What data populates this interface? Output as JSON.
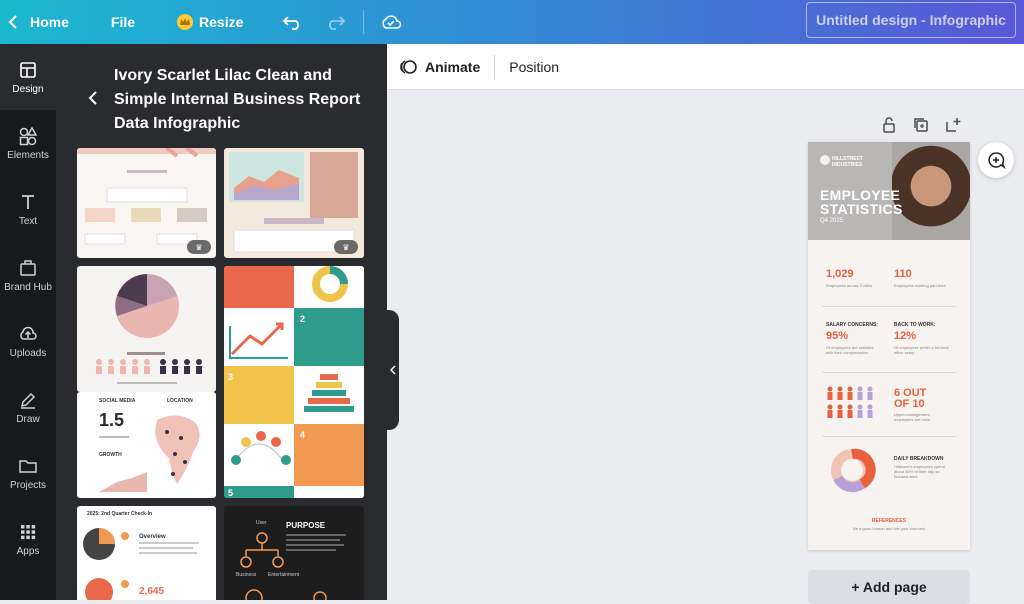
{
  "topbar": {
    "home_label": "Home",
    "file_label": "File",
    "resize_label": "Resize",
    "doc_title": "Untitled design - Infographic"
  },
  "rail": {
    "items": [
      {
        "label": "Design",
        "icon": "layout-icon"
      },
      {
        "label": "Elements",
        "icon": "shapes-icon"
      },
      {
        "label": "Text",
        "icon": "text-icon"
      },
      {
        "label": "Brand Hub",
        "icon": "brand-hub-icon"
      },
      {
        "label": "Uploads",
        "icon": "upload-icon"
      },
      {
        "label": "Draw",
        "icon": "draw-icon"
      },
      {
        "label": "Projects",
        "icon": "folder-icon"
      },
      {
        "label": "Apps",
        "icon": "apps-icon"
      }
    ]
  },
  "panel": {
    "title": "Ivory Scarlet Lilac Clean and Simple Internal Business Report Data Infographic"
  },
  "thumbnails": {
    "t5_stat": "1.5",
    "t5_social": "SOCIAL MEDIA",
    "t5_location": "LOCATION",
    "t5_growth": "GROWTH",
    "t7_heading": "2025: 2nd Quarter Check-In",
    "t7_overview": "Overview",
    "t7_number": "2,645",
    "t8_purpose": "PURPOSE",
    "t8_user": "User",
    "t8_business": "Business",
    "t8_entertainment": "Entertainment",
    "t4_num2": "2",
    "t4_num3": "3",
    "t4_num4": "4",
    "t4_num5": "5"
  },
  "toolbar2": {
    "animate_label": "Animate",
    "position_label": "Position"
  },
  "design": {
    "company": "HILLSTREET INDUSTRIES",
    "title": "EMPLOYEE STATISTICS",
    "subtitle": "Q4 2025",
    "stat1": "1,029",
    "stat1_text": "Employees across 3 cities",
    "stat2": "110",
    "stat2_text": "Employees working part-time",
    "label3": "SALARY CONCERNS:",
    "stat3": "95%",
    "stat3_text": "Of employees are satisfied with their compensation",
    "label4": "BACK TO WORK:",
    "stat4": "12%",
    "stat4_text": "Of employees prefer a full-time office setup",
    "stat5": "6 OUT OF 10",
    "stat5_text": "Upper-management employees are male",
    "label6": "DAILY BREAKDOWN",
    "stat6_text": "Hillstreet's employees spend about 56% of their day on focused work",
    "references": "REFERENCES",
    "references_text": "Be a good human and cite your sources!"
  },
  "add_page_label": "+ Add page"
}
